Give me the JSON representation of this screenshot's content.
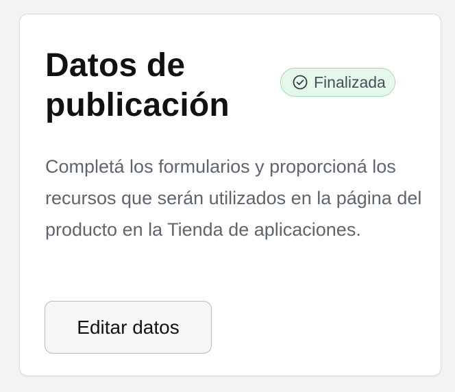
{
  "card": {
    "title": "Datos de publicación",
    "status": {
      "label": "Finalizada",
      "icon": "check-circle-icon",
      "color": "#1f9a4f",
      "background": "#e6f7ec"
    },
    "description": "Completá los formularios y proporcioná los recursos que serán utilizados en la página del producto en la Tienda de aplicaciones.",
    "edit_button_label": "Editar datos"
  }
}
